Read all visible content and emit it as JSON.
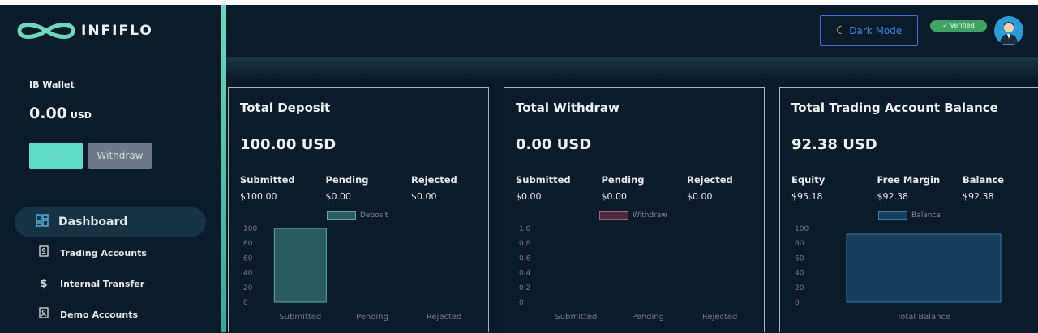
{
  "app": {
    "logo_text": "INFIFLO"
  },
  "sidebar": {
    "wallet_label": "IB Wallet",
    "wallet_value": "0.00",
    "wallet_unit": "USD",
    "deposit_label": "Deposit",
    "withdraw_label": "Withdraw",
    "nav": [
      {
        "label": "Dashboard",
        "icon": "dashboard-grid-icon",
        "active": true
      },
      {
        "label": "Trading Accounts",
        "icon": "account-card-icon"
      },
      {
        "label": "Internal Transfer",
        "icon": "dollar-icon"
      },
      {
        "label": "Demo Accounts",
        "icon": "account-card-icon"
      }
    ]
  },
  "header": {
    "dark_mode_label": "Dark Mode",
    "verified_label": "✓ Verified"
  },
  "cards": [
    {
      "title": "Total Deposit",
      "amount": "100.00 USD",
      "stats": [
        {
          "label": "Submitted",
          "value": "$100.00"
        },
        {
          "label": "Pending",
          "value": "$0.00"
        },
        {
          "label": "Rejected",
          "value": "$0.00"
        }
      ]
    },
    {
      "title": "Total Withdraw",
      "amount": "0.00 USD",
      "stats": [
        {
          "label": "Submitted",
          "value": "$0.00"
        },
        {
          "label": "Pending",
          "value": "$0.00"
        },
        {
          "label": "Rejected",
          "value": "$0.00"
        }
      ]
    },
    {
      "title": "Total Trading Account Balance",
      "amount": "92.38 USD",
      "stats": [
        {
          "label": "Equity",
          "value": "$95.18"
        },
        {
          "label": "Free Margin",
          "value": "$92.38"
        },
        {
          "label": "Balance",
          "value": "$92.38"
        }
      ]
    }
  ],
  "chart_data": [
    {
      "type": "bar",
      "categories": [
        "Submitted",
        "Pending",
        "Rejected"
      ],
      "series": [
        {
          "name": "Deposit",
          "values": [
            100,
            0,
            0
          ]
        }
      ],
      "ylim": [
        0,
        100
      ],
      "yticks": [
        "100",
        "80",
        "60",
        "40",
        "20",
        "0"
      ],
      "color": "#2a5a62",
      "border": "#5fa7ae"
    },
    {
      "type": "bar",
      "categories": [
        "Submitted",
        "Pending",
        "Rejected"
      ],
      "series": [
        {
          "name": "Withdraw",
          "values": [
            0,
            0,
            0
          ]
        }
      ],
      "ylim": [
        0,
        1.0
      ],
      "yticks": [
        "1.0",
        "0.8",
        "0.6",
        "0.4",
        "0.2",
        "0"
      ],
      "color": "#4a2a3f",
      "border": "#b1577c"
    },
    {
      "type": "bar",
      "categories": [
        "Total Balance"
      ],
      "series": [
        {
          "name": "Balance",
          "values": [
            92.38
          ]
        }
      ],
      "ylim": [
        0,
        100
      ],
      "yticks": [
        "100",
        "80",
        "60",
        "40",
        "20",
        "0"
      ],
      "color": "#163d5c",
      "border": "#2f7fba"
    }
  ]
}
